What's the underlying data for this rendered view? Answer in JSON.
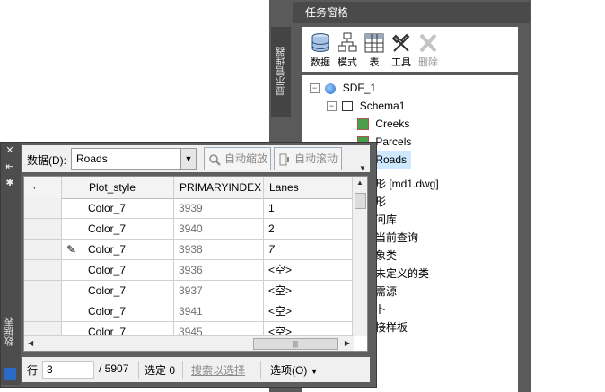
{
  "task_pane": {
    "title": "任务窗格",
    "side_tab": "显示管理器",
    "toolbar": [
      {
        "label": "数据",
        "icon": "database-icon",
        "disabled": false
      },
      {
        "label": "模式",
        "icon": "schema-icon",
        "disabled": false
      },
      {
        "label": "表",
        "icon": "table-icon",
        "disabled": false
      },
      {
        "label": "工具",
        "icon": "tools-icon",
        "disabled": false
      },
      {
        "label": "删除",
        "icon": "delete-icon",
        "disabled": true
      }
    ],
    "tree": [
      {
        "label": "SDF_1",
        "icon": "datasource-icon",
        "toggle": "−"
      },
      {
        "label": "Schema1",
        "icon": "schema-icon",
        "toggle": "−"
      },
      {
        "label": "Creeks",
        "icon": "feature-class-icon"
      },
      {
        "label": "Parcels",
        "icon": "feature-class-icon"
      },
      {
        "label": "Roads",
        "icon": "feature-class-icon",
        "selected": true
      },
      {
        "label": "形 [md1.dwg]"
      },
      {
        "label": "形"
      },
      {
        "label": "间库"
      },
      {
        "label": "当前查询"
      },
      {
        "label": "象类"
      },
      {
        "label": "未定义的类"
      },
      {
        "label": "需源"
      },
      {
        "label": "卜"
      },
      {
        "label": "接样板"
      }
    ]
  },
  "data_table": {
    "side_title": "数据表",
    "source_label": "数据(D):",
    "source_value": "Roads",
    "zoom_button": "自动缩放",
    "scroll_button": "自动滚动",
    "columns": [
      "Plot_style",
      "PRIMARYINDEX",
      "Lanes"
    ],
    "rows": [
      {
        "marker": "",
        "plot_style": "Color_7",
        "primaryindex": "3939",
        "lanes": "1"
      },
      {
        "marker": "",
        "plot_style": "Color_7",
        "primaryindex": "3940",
        "lanes": "2"
      },
      {
        "marker": "✎",
        "plot_style": "Color_7",
        "primaryindex": "3938",
        "lanes": "7"
      },
      {
        "marker": "",
        "plot_style": "Color_7",
        "primaryindex": "3936",
        "lanes": "<空>"
      },
      {
        "marker": "",
        "plot_style": "Color_7",
        "primaryindex": "3937",
        "lanes": "<空>"
      },
      {
        "marker": "",
        "plot_style": "Color_7",
        "primaryindex": "3941",
        "lanes": "<空>"
      },
      {
        "marker": "",
        "plot_style": "Color_7",
        "primaryindex": "3945",
        "lanes": "<空>"
      }
    ],
    "status": {
      "row_label": "行",
      "row_value": "3",
      "total": "/ 5907",
      "selected": "选定 0",
      "search_link": "搜索以选择",
      "options": "选项(O)"
    }
  },
  "colors": {
    "pane_dark": "#5a5a5a",
    "selection": "#cde8ff",
    "feature_green": "#4aa04a"
  }
}
